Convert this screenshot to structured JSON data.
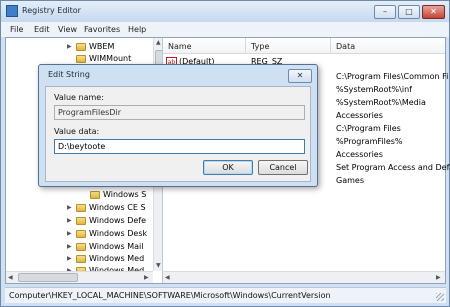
{
  "window": {
    "title": "Registry Editor",
    "controls": {
      "minimize": "–",
      "maximize": "□",
      "close": "✕"
    }
  },
  "menu": [
    "File",
    "Edit",
    "View",
    "Favorites",
    "Help"
  ],
  "tree": {
    "items": [
      {
        "label": "WBEM",
        "expander": "▶"
      },
      {
        "label": "WIMMount",
        "expander": ""
      },
      {
        "label": "Windows S",
        "expander": ""
      },
      {
        "label": "Windows CE S",
        "expander": "▶"
      },
      {
        "label": "Windows Defe",
        "expander": "▶"
      },
      {
        "label": "Windows Desk",
        "expander": "▶"
      },
      {
        "label": "Windows Mail",
        "expander": "▶"
      },
      {
        "label": "Windows Med",
        "expander": "▶"
      },
      {
        "label": "Windows Med",
        "expander": "▶"
      }
    ]
  },
  "list": {
    "columns": {
      "name": "Name",
      "type": "Type",
      "data": "Data"
    },
    "rows": [
      {
        "name": "(Default)",
        "type": "REG_SZ",
        "data": ""
      },
      {
        "name": "",
        "type": "",
        "data": "C:\\Program Files\\Common Fi"
      },
      {
        "name": "",
        "type": "",
        "data": "%SystemRoot%\\inf"
      },
      {
        "name": "",
        "type": "",
        "data": "%SystemRoot%\\Media"
      },
      {
        "name": "",
        "type": "",
        "data": "Accessories"
      },
      {
        "name": "",
        "type": "",
        "data": "C:\\Program Files"
      },
      {
        "name": "",
        "type": "",
        "data": "%ProgramFiles%"
      },
      {
        "name": "",
        "type": "",
        "data": "Accessories"
      },
      {
        "name": "",
        "type": "",
        "data": "Set Program Access and Defa"
      },
      {
        "name": "",
        "type": "",
        "data": "Games"
      }
    ]
  },
  "status_bar": {
    "path": "Computer\\HKEY_LOCAL_MACHINE\\SOFTWARE\\Microsoft\\Windows\\CurrentVersion"
  },
  "dialog": {
    "title": "Edit String",
    "close": "✕",
    "value_name_label": "Value name:",
    "value_name": "ProgramFilesDir",
    "value_data_label": "Value data:",
    "value_data": "D:\\beytoote",
    "ok_label": "OK",
    "cancel_label": "Cancel"
  },
  "scroll_arrows": {
    "up": "▲",
    "down": "▼",
    "left": "◀",
    "right": "▶"
  }
}
